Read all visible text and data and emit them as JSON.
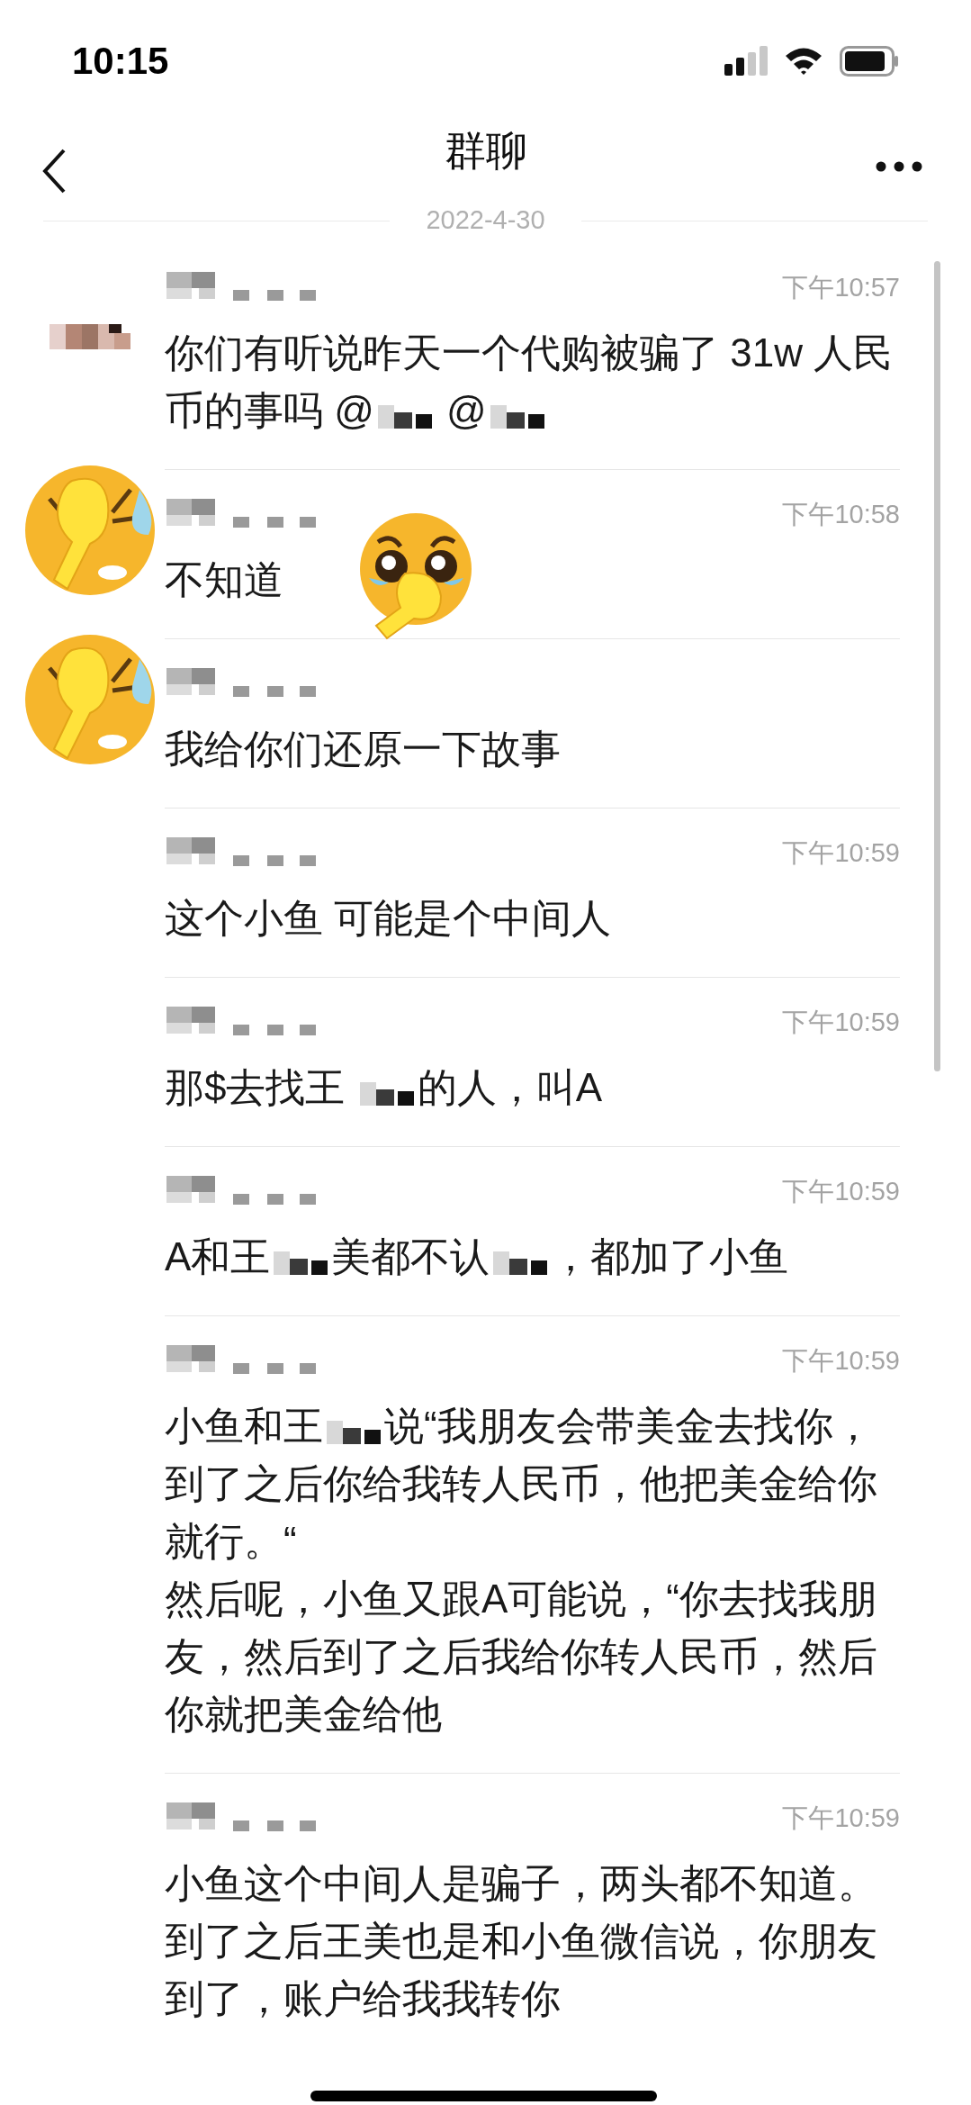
{
  "status_bar": {
    "time": "10:15"
  },
  "header": {
    "title": "群聊"
  },
  "date_divider": "2022-4-30",
  "messages": [
    {
      "kind": "photo",
      "time": "下午10:57",
      "parts": [
        {
          "kind": "text",
          "text": "你们有听说昨天一个代购被骗了 31w 人民币的事吗 @"
        },
        {
          "kind": "redacted"
        },
        {
          "kind": "text",
          "text": " @"
        },
        {
          "kind": "redacted"
        }
      ]
    },
    {
      "kind": "emoji",
      "time": "下午10:58",
      "sticker": true,
      "parts": [
        {
          "kind": "text",
          "text": "不知道"
        }
      ]
    },
    {
      "kind": "emoji",
      "parts": [
        {
          "kind": "text",
          "text": "我给你们还原一下故事"
        }
      ]
    },
    {
      "kind": "plain",
      "time": "下午10:59",
      "parts": [
        {
          "kind": "text",
          "text": "这个小鱼 可能是个中间人"
        }
      ]
    },
    {
      "kind": "plain",
      "time": "下午10:59",
      "parts": [
        {
          "kind": "text",
          "text": "那$去找王 "
        },
        {
          "kind": "redacted"
        },
        {
          "kind": "text",
          "text": "的人，叫A"
        }
      ]
    },
    {
      "kind": "plain",
      "time": "下午10:59",
      "parts": [
        {
          "kind": "text",
          "text": "A和王"
        },
        {
          "kind": "redacted"
        },
        {
          "kind": "text",
          "text": "美都不认"
        },
        {
          "kind": "redacted"
        },
        {
          "kind": "text",
          "text": "，都加了小鱼"
        }
      ]
    },
    {
      "kind": "plain",
      "time": "下午10:59",
      "parts": [
        {
          "kind": "text",
          "text": "小鱼和王"
        },
        {
          "kind": "redacted"
        },
        {
          "kind": "text",
          "text": "说“我朋友会带美金去找你，到了之后你给我转人民币，他把美金给你就行。“"
        },
        {
          "kind": "break"
        },
        {
          "kind": "text",
          "text": "然后呢，小鱼又跟A可能说，“你去找我朋友，然后到了之后我给你转人民币，然后你就把美金给他"
        }
      ]
    },
    {
      "kind": "plain",
      "time": "下午10:59",
      "parts": [
        {
          "kind": "text",
          "text": "小鱼这个中间人是骗子，两头都不知道。"
        },
        {
          "kind": "break"
        },
        {
          "kind": "text",
          "text": "到了之后王美也是和小鱼微信说，你朋友到了，账户给我我转你"
        }
      ]
    }
  ]
}
